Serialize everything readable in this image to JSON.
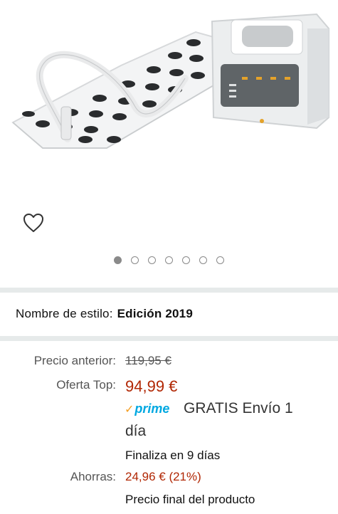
{
  "product": {
    "image_alt": "product-image-bath-massager"
  },
  "carousel": {
    "count": 7,
    "active": 0
  },
  "style": {
    "label": "Nombre de estilo:",
    "value": "Edición 2019"
  },
  "pricing": {
    "previous_label": "Precio anterior:",
    "previous_price": "119,95 €",
    "offer_label": "Oferta Top:",
    "offer_price": "94,99 €",
    "prime_label": "prime",
    "shipping_line1": "GRATIS Envío 1",
    "shipping_line2": "día",
    "ends_in": "Finaliza en 9 días",
    "savings_label": "Ahorras:",
    "savings_value": "24,96 € (21%)",
    "final_note": "Precio final del producto"
  },
  "colors": {
    "price": "#b12704",
    "prime": "#00a8e1",
    "separator": "#e6eaea"
  }
}
